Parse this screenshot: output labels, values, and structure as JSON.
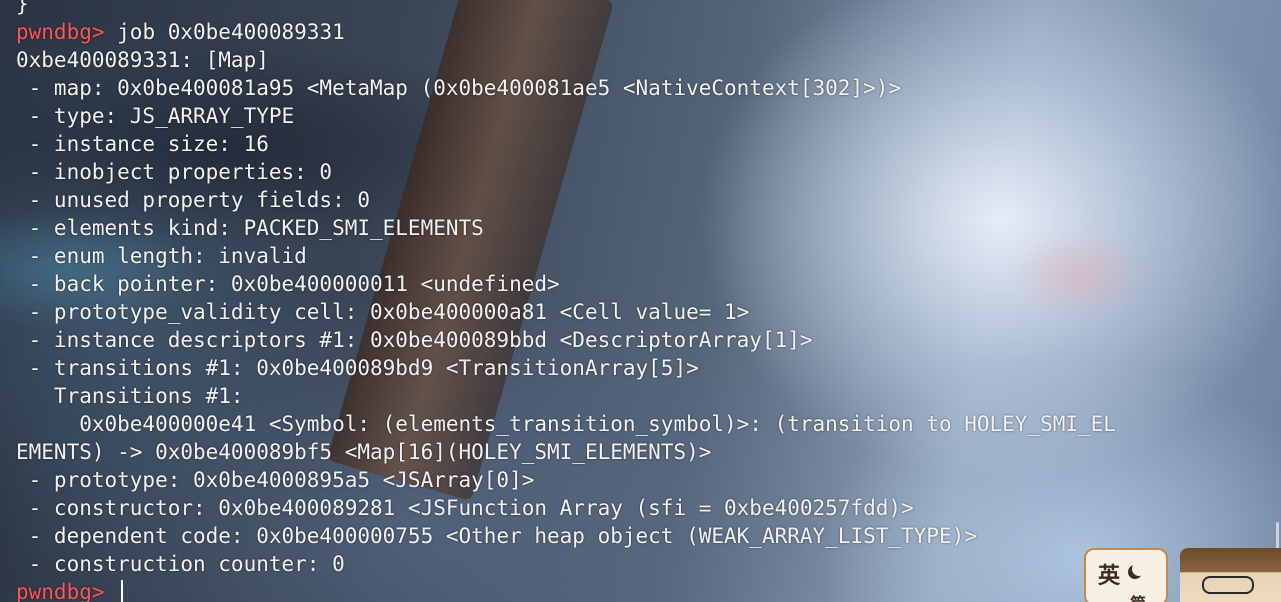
{
  "terminal": {
    "prompt": "pwndbg>",
    "lines": [
      {
        "type": "text",
        "text": "}"
      },
      {
        "type": "prompt",
        "cmd": " job 0x0be400089331"
      },
      {
        "type": "text",
        "text": "0xbe400089331: [Map]"
      },
      {
        "type": "text",
        "text": " - map: 0x0be400081a95 <MetaMap (0x0be400081ae5 <NativeContext[302]>)>"
      },
      {
        "type": "text",
        "text": " - type: JS_ARRAY_TYPE"
      },
      {
        "type": "text",
        "text": " - instance size: 16"
      },
      {
        "type": "text",
        "text": " - inobject properties: 0"
      },
      {
        "type": "text",
        "text": " - unused property fields: 0"
      },
      {
        "type": "text",
        "text": " - elements kind: PACKED_SMI_ELEMENTS"
      },
      {
        "type": "text",
        "text": " - enum length: invalid"
      },
      {
        "type": "text",
        "text": " - back pointer: 0x0be400000011 <undefined>"
      },
      {
        "type": "text",
        "text": " - prototype_validity cell: 0x0be400000a81 <Cell value= 1>"
      },
      {
        "type": "text",
        "text": " - instance descriptors #1: 0x0be400089bbd <DescriptorArray[1]>"
      },
      {
        "type": "text",
        "text": " - transitions #1: 0x0be400089bd9 <TransitionArray[5]>"
      },
      {
        "type": "text",
        "text": "   Transitions #1:"
      },
      {
        "type": "text",
        "text": "     0x0be400000e41 <Symbol: (elements_transition_symbol)>: (transition to HOLEY_SMI_EL"
      },
      {
        "type": "text",
        "text": "EMENTS) -> 0x0be400089bf5 <Map[16](HOLEY_SMI_ELEMENTS)>"
      },
      {
        "type": "text",
        "text": " - prototype: 0x0be4000895a5 <JSArray[0]>"
      },
      {
        "type": "text",
        "text": " - constructor: 0x0be400089281 <JSFunction Array (sfi = 0xbe400257fdd)>"
      },
      {
        "type": "text",
        "text": " - dependent code: 0x0be400000755 <Other heap object (WEAK_ARRAY_LIST_TYPE)>"
      },
      {
        "type": "text",
        "text": " - construction counter: 0"
      },
      {
        "type": "prompt",
        "cmd": " "
      }
    ]
  },
  "ime": {
    "char_main": "英",
    "char_sub": "简",
    "icon": "moon-icon"
  },
  "colors": {
    "prompt": "#ff5555",
    "text": "#f2f2f2"
  }
}
